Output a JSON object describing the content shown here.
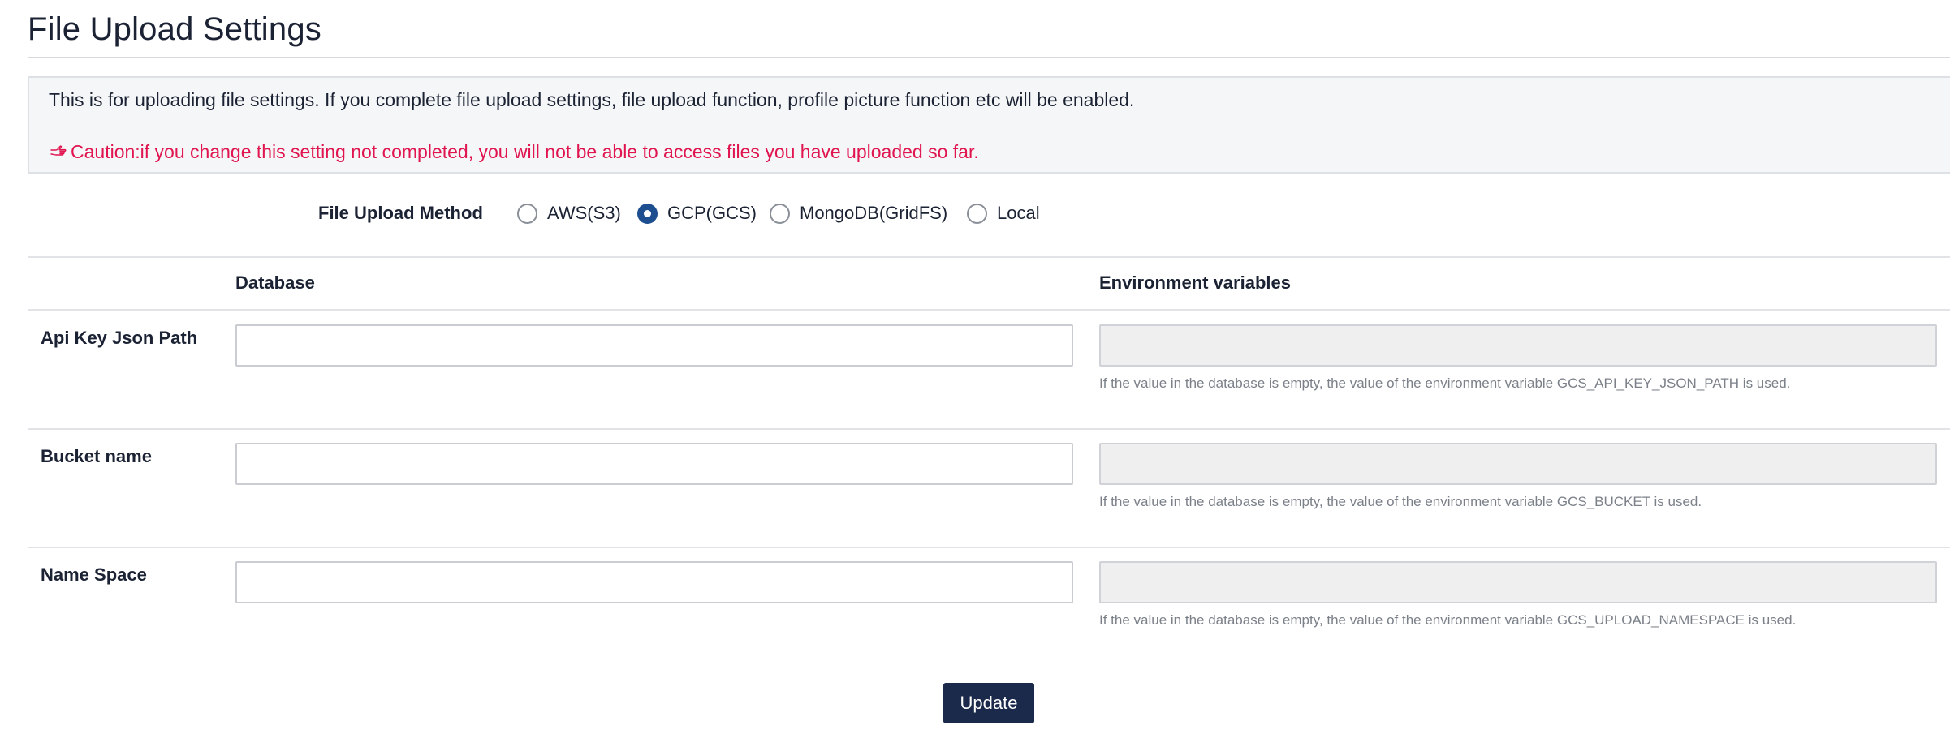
{
  "page": {
    "title": "File Upload Settings"
  },
  "info": {
    "description": "This is for uploading file settings. If you complete file upload settings, file upload function, profile picture function etc will be enabled.",
    "caution_icon": "hand-pointing-icon",
    "caution": "Caution:if you change this setting not completed, you will not be able to access files you have uploaded so far."
  },
  "method": {
    "label": "File Upload Method",
    "options": [
      {
        "label": "AWS(S3)",
        "checked": false
      },
      {
        "label": "GCP(GCS)",
        "checked": true
      },
      {
        "label": "MongoDB(GridFS)",
        "checked": false
      },
      {
        "label": "Local",
        "checked": false
      }
    ]
  },
  "columns": {
    "database": "Database",
    "env": "Environment variables"
  },
  "rows": [
    {
      "label": "Api Key Json Path",
      "db_value": "",
      "env_value": "",
      "help": "If the value in the database is empty, the value of the environment variable GCS_API_KEY_JSON_PATH is used."
    },
    {
      "label": "Bucket name",
      "db_value": "",
      "env_value": "",
      "help": "If the value in the database is empty, the value of the environment variable GCS_BUCKET is used."
    },
    {
      "label": "Name Space",
      "db_value": "",
      "env_value": "",
      "help": "If the value in the database is empty, the value of the environment variable GCS_UPLOAD_NAMESPACE is used."
    }
  ],
  "actions": {
    "update": "Update"
  },
  "colors": {
    "accent": "#1d4e8f",
    "button": "#1b2a4a",
    "caution": "#e0144f"
  }
}
